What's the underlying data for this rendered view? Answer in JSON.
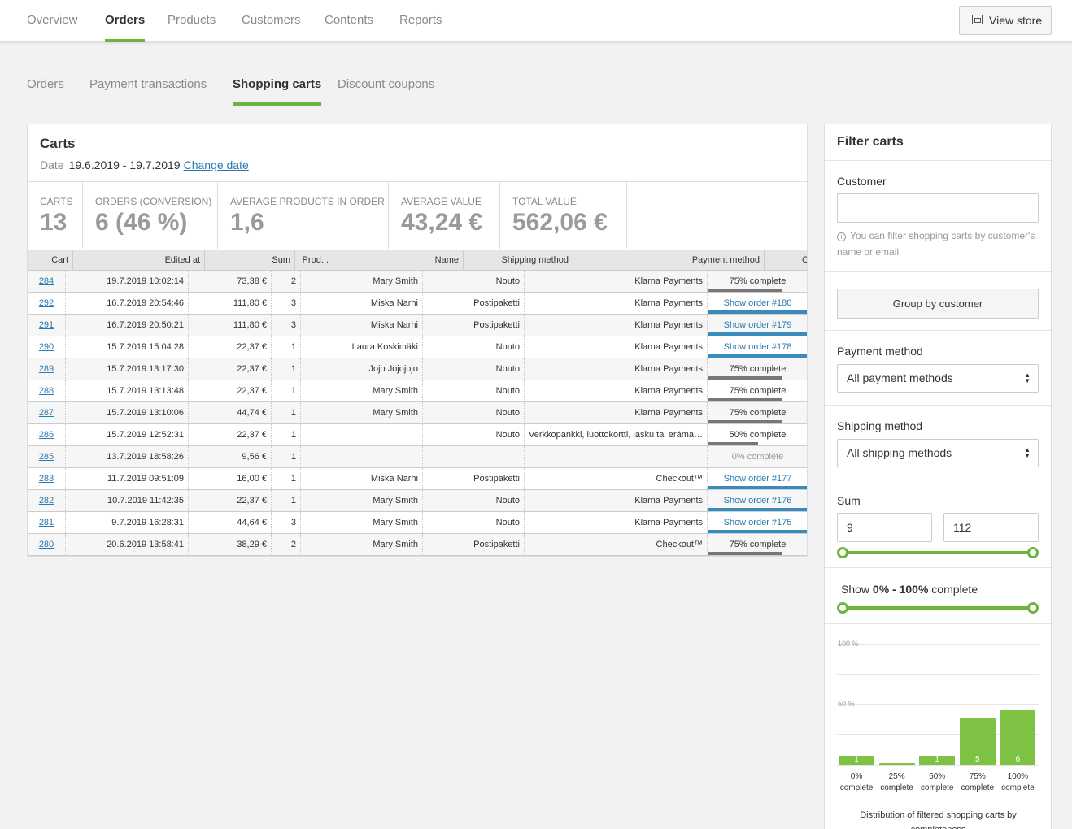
{
  "top_nav": {
    "items": [
      "Overview",
      "Orders",
      "Products",
      "Customers",
      "Contents",
      "Reports"
    ],
    "active": "Orders",
    "view_store": "View store"
  },
  "sub_nav": {
    "items": [
      "Orders",
      "Payment transactions",
      "Shopping carts",
      "Discount coupons"
    ],
    "active": "Shopping carts"
  },
  "carts": {
    "title": "Carts",
    "date_label": "Date",
    "date_value": "19.6.2019 - 19.7.2019",
    "change_date": "Change date",
    "stats": [
      {
        "label": "CARTS",
        "value": "13"
      },
      {
        "label": "ORDERS (CONVERSION)",
        "value": "6 (46 %)"
      },
      {
        "label": "AVERAGE PRODUCTS IN ORDER",
        "value": "1,6"
      },
      {
        "label": "AVERAGE VALUE",
        "value": "43,24 €"
      },
      {
        "label": "TOTAL VALUE",
        "value": "562,06 €"
      }
    ],
    "columns": [
      "Cart",
      "Edited at",
      "Sum",
      "Prod...",
      "Name",
      "Shipping method",
      "Payment method",
      "C"
    ],
    "rows": [
      {
        "cart": "284",
        "edited": "19.7.2019 10:02:14",
        "sum": "73,38 €",
        "prod": "2",
        "name": "Mary Smith",
        "shipping": "Nouto",
        "payment": "Klarna Payments",
        "status": "75% complete",
        "status_type": "progress",
        "fill": 0.75
      },
      {
        "cart": "292",
        "edited": "16.7.2019 20:54:46",
        "sum": "111,80 €",
        "prod": "3",
        "name": "Miska Narhi",
        "shipping": "Postipaketti",
        "payment": "Klarna Payments",
        "status": "Show order #180",
        "status_type": "order",
        "fill": 1.0
      },
      {
        "cart": "291",
        "edited": "16.7.2019 20:50:21",
        "sum": "111,80 €",
        "prod": "3",
        "name": "Miska Narhi",
        "shipping": "Postipaketti",
        "payment": "Klarna Payments",
        "status": "Show order #179",
        "status_type": "order",
        "fill": 1.0
      },
      {
        "cart": "290",
        "edited": "15.7.2019 15:04:28",
        "sum": "22,37 €",
        "prod": "1",
        "name": "Laura Koskimäki",
        "shipping": "Nouto",
        "payment": "Klarna Payments",
        "status": "Show order #178",
        "status_type": "order",
        "fill": 1.0
      },
      {
        "cart": "289",
        "edited": "15.7.2019 13:17:30",
        "sum": "22,37 €",
        "prod": "1",
        "name": "Jojo Jojojojo",
        "shipping": "Nouto",
        "payment": "Klarna Payments",
        "status": "75% complete",
        "status_type": "progress",
        "fill": 0.75
      },
      {
        "cart": "288",
        "edited": "15.7.2019 13:13:48",
        "sum": "22,37 €",
        "prod": "1",
        "name": "Mary Smith",
        "shipping": "Nouto",
        "payment": "Klarna Payments",
        "status": "75% complete",
        "status_type": "progress",
        "fill": 0.75
      },
      {
        "cart": "287",
        "edited": "15.7.2019 13:10:06",
        "sum": "44,74 €",
        "prod": "1",
        "name": "Mary Smith",
        "shipping": "Nouto",
        "payment": "Klarna Payments",
        "status": "75% complete",
        "status_type": "progress",
        "fill": 0.75
      },
      {
        "cart": "286",
        "edited": "15.7.2019 12:52:31",
        "sum": "22,37 €",
        "prod": "1",
        "name": "",
        "shipping": "Nouto",
        "payment": "Verkkopankki, luottokortti, lasku tai erämaksu",
        "status": "50% complete",
        "status_type": "progress",
        "fill": 0.5
      },
      {
        "cart": "285",
        "edited": "13.7.2019 18:58:26",
        "sum": "9,56 €",
        "prod": "1",
        "name": "",
        "shipping": "",
        "payment": "",
        "status": "0% complete",
        "status_type": "empty",
        "fill": 0
      },
      {
        "cart": "283",
        "edited": "11.7.2019 09:51:09",
        "sum": "16,00 €",
        "prod": "1",
        "name": "Miska Narhi",
        "shipping": "Postipaketti",
        "payment": "Checkout™",
        "status": "Show order #177",
        "status_type": "order",
        "fill": 1.0
      },
      {
        "cart": "282",
        "edited": "10.7.2019 11:42:35",
        "sum": "22,37 €",
        "prod": "1",
        "name": "Mary Smith",
        "shipping": "Nouto",
        "payment": "Klarna Payments",
        "status": "Show order #176",
        "status_type": "order",
        "fill": 1.0
      },
      {
        "cart": "281",
        "edited": "9.7.2019 16:28:31",
        "sum": "44,64 €",
        "prod": "3",
        "name": "Mary Smith",
        "shipping": "Nouto",
        "payment": "Klarna Payments",
        "status": "Show order #175",
        "status_type": "order",
        "fill": 1.0
      },
      {
        "cart": "280",
        "edited": "20.6.2019 13:58:41",
        "sum": "38,29 €",
        "prod": "2",
        "name": "Mary Smith",
        "shipping": "Postipaketti",
        "payment": "Checkout™",
        "status": "75% complete",
        "status_type": "progress",
        "fill": 0.75
      }
    ]
  },
  "filter": {
    "title": "Filter carts",
    "customer_label": "Customer",
    "customer_value": "",
    "customer_help": "You can filter shopping carts by customer's name or email.",
    "group_button": "Group by customer",
    "payment_label": "Payment method",
    "payment_value": "All payment methods",
    "shipping_label": "Shipping method",
    "shipping_value": "All shipping methods",
    "sum_label": "Sum",
    "sum_min": "9",
    "sum_max": "112",
    "sum_separator": "-",
    "complete_prefix": "Show ",
    "complete_range": "0% - 100%",
    "complete_suffix": " complete"
  },
  "colors": {
    "accent": "#6db33f",
    "bar": "#7dc242",
    "order": "#3a8bbd",
    "progress": "#777777",
    "link": "#2a7ab0"
  },
  "chart_data": {
    "type": "bar",
    "title": "",
    "categories": [
      "0% complete",
      "25% complete",
      "50% complete",
      "75% complete",
      "100% complete"
    ],
    "values": [
      1,
      0,
      1,
      5,
      6
    ],
    "ylim": [
      0,
      100
    ],
    "y_ticks": [
      "100 %",
      "50 %"
    ],
    "caption": "Distribution of filtered shopping carts by completeness"
  }
}
